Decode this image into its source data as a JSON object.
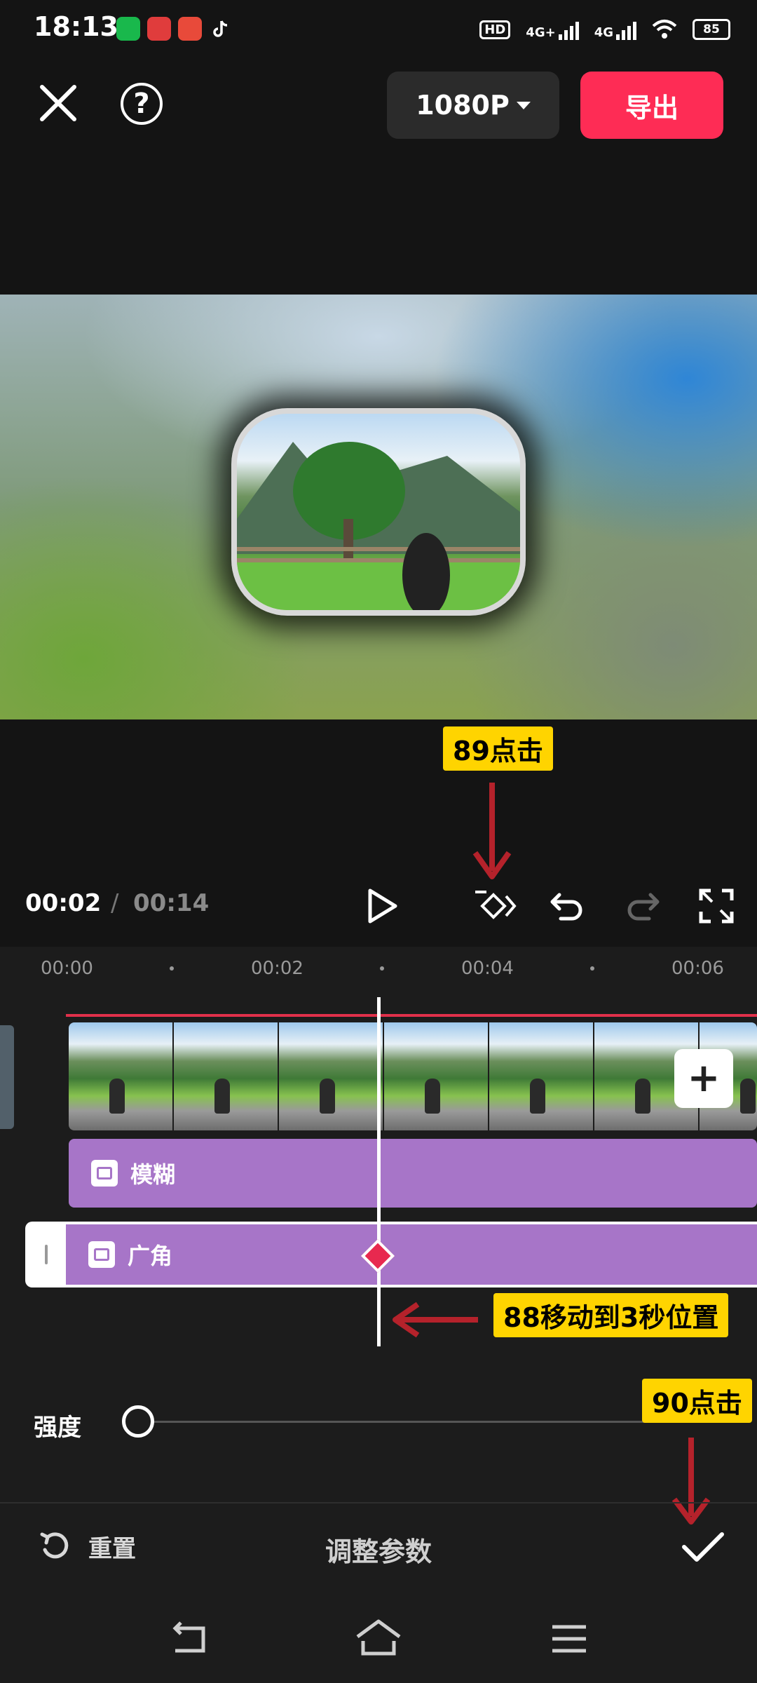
{
  "status_bar": {
    "time": "18:13",
    "network_1": "4G+",
    "network_2": "4G",
    "battery": "85"
  },
  "toolbar": {
    "close_icon": "close-icon",
    "help_label": "?",
    "resolution": "1080P",
    "export_label": "导出"
  },
  "annotations": {
    "step_89": "89点击",
    "step_88": "88移动到3秒位置",
    "step_90": "90点击",
    "arrow_color": "#b5222b",
    "label_color": "#ffd400"
  },
  "player": {
    "current_time": "00:02",
    "separator": "/",
    "total_time": "00:14"
  },
  "timeline": {
    "ruler": [
      "00:00",
      "00:02",
      "00:04",
      "00:06"
    ],
    "tracks": [
      {
        "label": "模糊"
      },
      {
        "label": "广角"
      }
    ],
    "add_clip_label": "+",
    "playhead_color": "#ffffff",
    "track_color": "#a775c8",
    "keyframe_color": "#e8294f"
  },
  "adjust": {
    "strength_label": "强度",
    "strength_value": 0
  },
  "bottom": {
    "reset_label": "重置",
    "title": "调整参数"
  },
  "colors": {
    "export_button": "#fe2c55",
    "background": "#141414"
  }
}
